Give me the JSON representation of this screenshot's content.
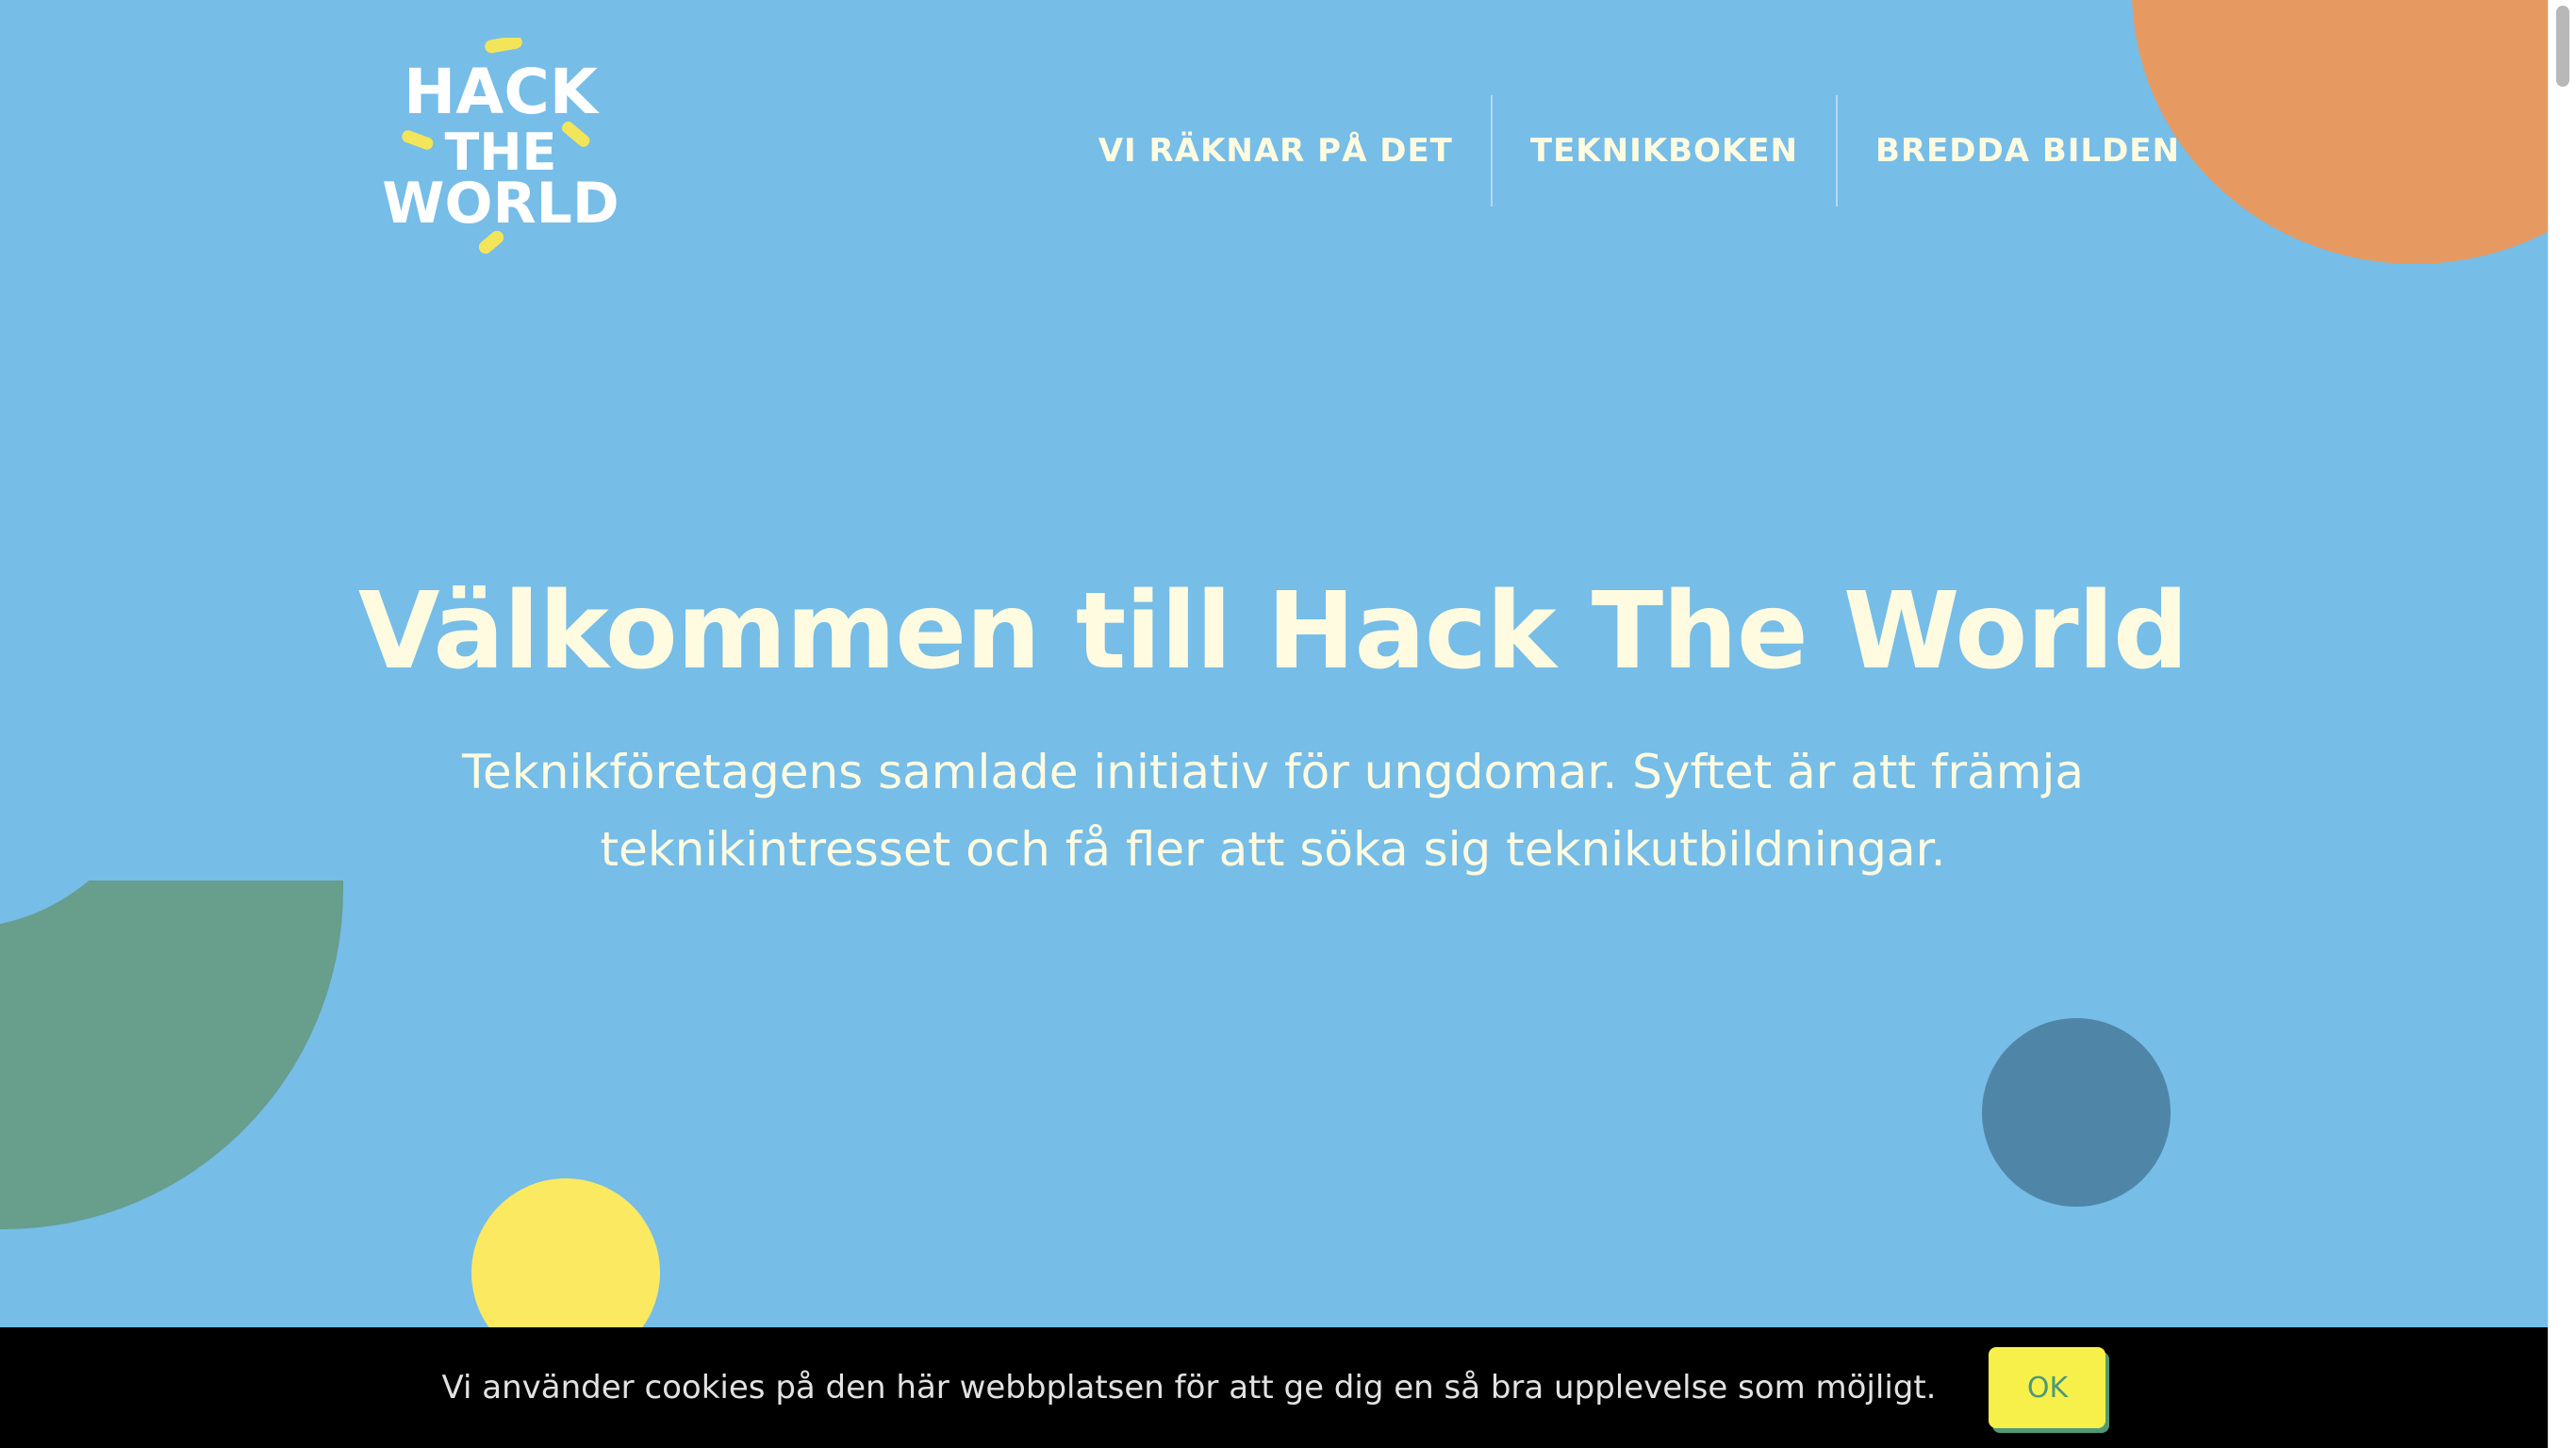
{
  "logo": {
    "line1": "HACK",
    "line2": "THE",
    "line3": "WORLD",
    "text_color": "#ffffff",
    "accent_color": "#f2e559"
  },
  "nav": {
    "items": [
      {
        "label": "VI RÄKNAR PÅ DET"
      },
      {
        "label": "TEKNIKBOKEN"
      },
      {
        "label": "BREDDA BILDEN"
      }
    ]
  },
  "hero": {
    "title": "Välkommen till Hack The World",
    "subtitle": "Teknikföretagens samlade initiativ för ungdomar. Syftet är att främja teknikintresset och få fler att söka sig teknikutbildningar."
  },
  "cookie": {
    "message": "Vi använder cookies på den här webbplatsen för att ge dig en så bra upplevelse som möjligt.",
    "ok_label": "OK"
  },
  "colors": {
    "background": "#76bde8",
    "text_light": "#fffbe0",
    "orange": "#e69a61",
    "green": "#679e8c",
    "yellow": "#fbe962",
    "dark_blue": "#4f86a8",
    "cookie_bar": "#000000",
    "button": "#f8f04a"
  }
}
